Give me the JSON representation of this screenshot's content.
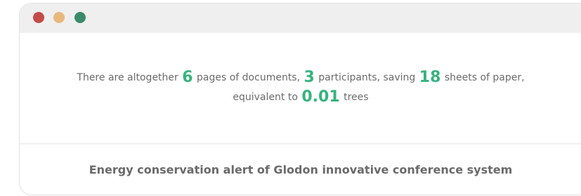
{
  "window": {
    "controls": [
      {
        "name": "close",
        "color": "#c44a48"
      },
      {
        "name": "minimize",
        "color": "#e9b77b"
      },
      {
        "name": "maximize",
        "color": "#3a8a6b"
      }
    ]
  },
  "stats": {
    "text_1": "There are altogether",
    "pages": "6",
    "text_2": "pages of documents,",
    "participants": "3",
    "text_3": "participants, saving",
    "sheets": "18",
    "text_4": "sheets of paper,",
    "text_5": "equivalent to",
    "trees": "0.01",
    "text_6": "trees"
  },
  "footer": {
    "title": "Energy conservation alert of Glodon innovative conference system"
  },
  "colors": {
    "accent": "#36b37e",
    "text": "#6b6b6b",
    "titlebar": "#efefef"
  }
}
